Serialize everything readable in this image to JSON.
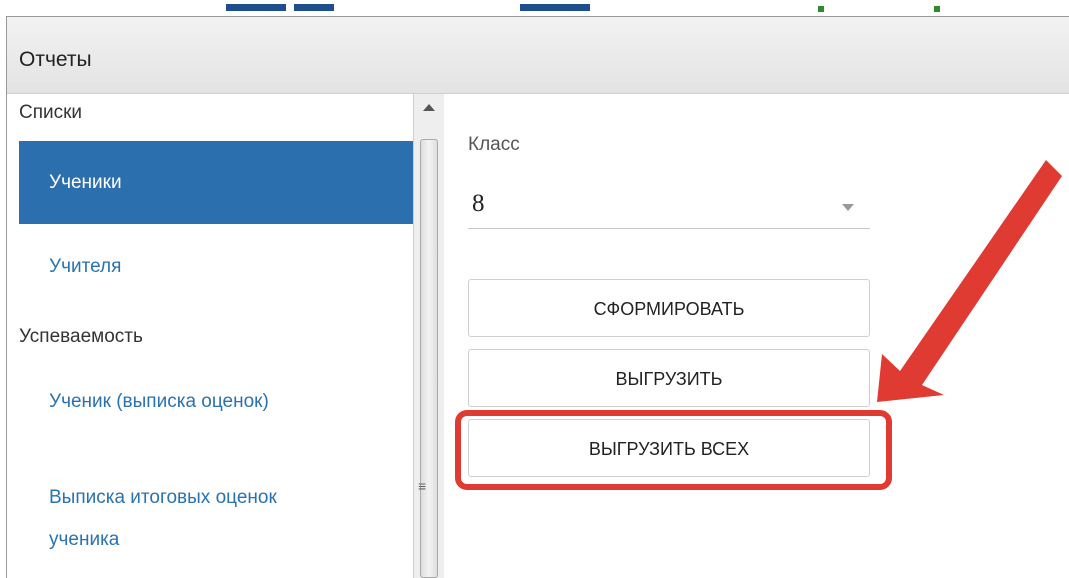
{
  "window": {
    "title": "Отчеты"
  },
  "sidebar": {
    "groups": [
      {
        "label": "Списки",
        "items": [
          {
            "label": "Ученики",
            "active": true
          },
          {
            "label": "Учителя",
            "active": false
          }
        ]
      },
      {
        "label": "Успеваемость",
        "items": [
          {
            "label": "Ученик (выписка оценок)",
            "active": false
          },
          {
            "label": "Выписка итоговых оценок",
            "label_line2": "ученика",
            "active": false
          }
        ]
      }
    ]
  },
  "scrollbar": {
    "grip_glyph": "≡"
  },
  "form": {
    "class_label": "Класс",
    "class_value": "8",
    "buttons": {
      "generate": "СФОРМИРОВАТЬ",
      "export": "ВЫГРУЗИТЬ",
      "export_all": "ВЫГРУЗИТЬ ВСЕХ"
    }
  },
  "annotation": {
    "highlight_color": "#e03b32",
    "target": "export_all"
  },
  "colors": {
    "active_item_bg": "#2c6fae",
    "link": "#2a72b0"
  }
}
